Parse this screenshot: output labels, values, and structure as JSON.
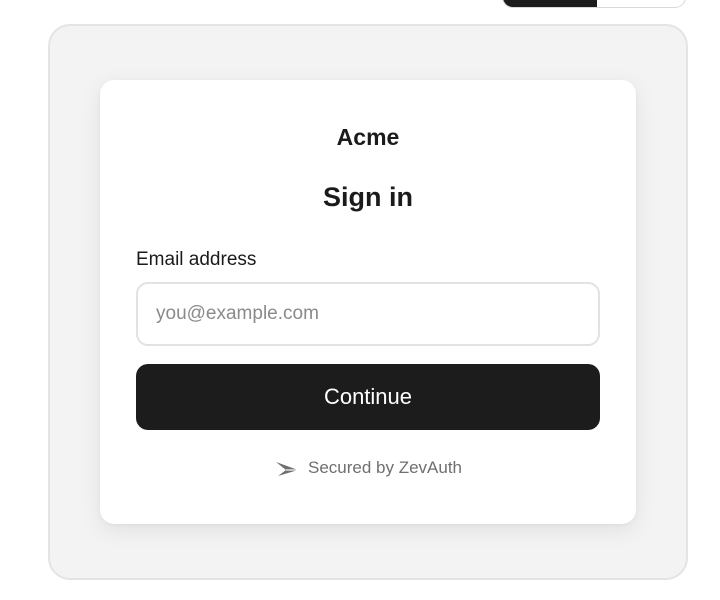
{
  "top_toggle": {
    "options": [
      "",
      ""
    ],
    "active_index": 0
  },
  "card": {
    "brand": "Acme",
    "title": "Sign in",
    "email": {
      "label": "Email address",
      "placeholder": "you@example.com",
      "value": ""
    },
    "continue_label": "Continue",
    "footer": {
      "secured_text": "Secured by ZevAuth",
      "logo_icon": "zevauth-logo-icon"
    }
  },
  "colors": {
    "page_background": "#ffffff",
    "frame_background": "#f3f3f3",
    "card_background": "#ffffff",
    "primary_button": "#1c1c1c",
    "primary_button_text": "#ffffff",
    "muted_text": "#6f6f6f"
  }
}
